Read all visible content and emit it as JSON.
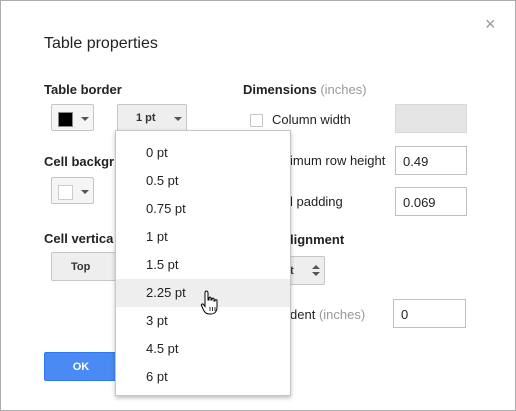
{
  "dialog": {
    "title": "Table properties",
    "close_glyph": "×"
  },
  "table_border": {
    "label": "Table border",
    "color": "#000000",
    "width_value": "1 pt"
  },
  "cell_background": {
    "label": "Cell backgr"
  },
  "cell_vertical": {
    "label": "Cell vertica",
    "value": "Top"
  },
  "dimensions": {
    "label": "Dimensions",
    "units": "(inches)",
    "column_width_label": "Column width",
    "min_row_height_label": "imum row height",
    "min_row_height_value": "0.49",
    "cell_padding_label": "l padding",
    "cell_padding_value": "0.069"
  },
  "alignment": {
    "label": "lignment",
    "select_value": "t"
  },
  "indent": {
    "label": "dent",
    "units": "(inches)",
    "value": "0"
  },
  "buttons": {
    "ok": "OK"
  },
  "border_menu": {
    "items": [
      "0 pt",
      "0.5 pt",
      "0.75 pt",
      "1 pt",
      "1.5 pt",
      "2.25 pt",
      "3 pt",
      "4.5 pt",
      "6 pt"
    ],
    "hovered": "2.25 pt"
  }
}
